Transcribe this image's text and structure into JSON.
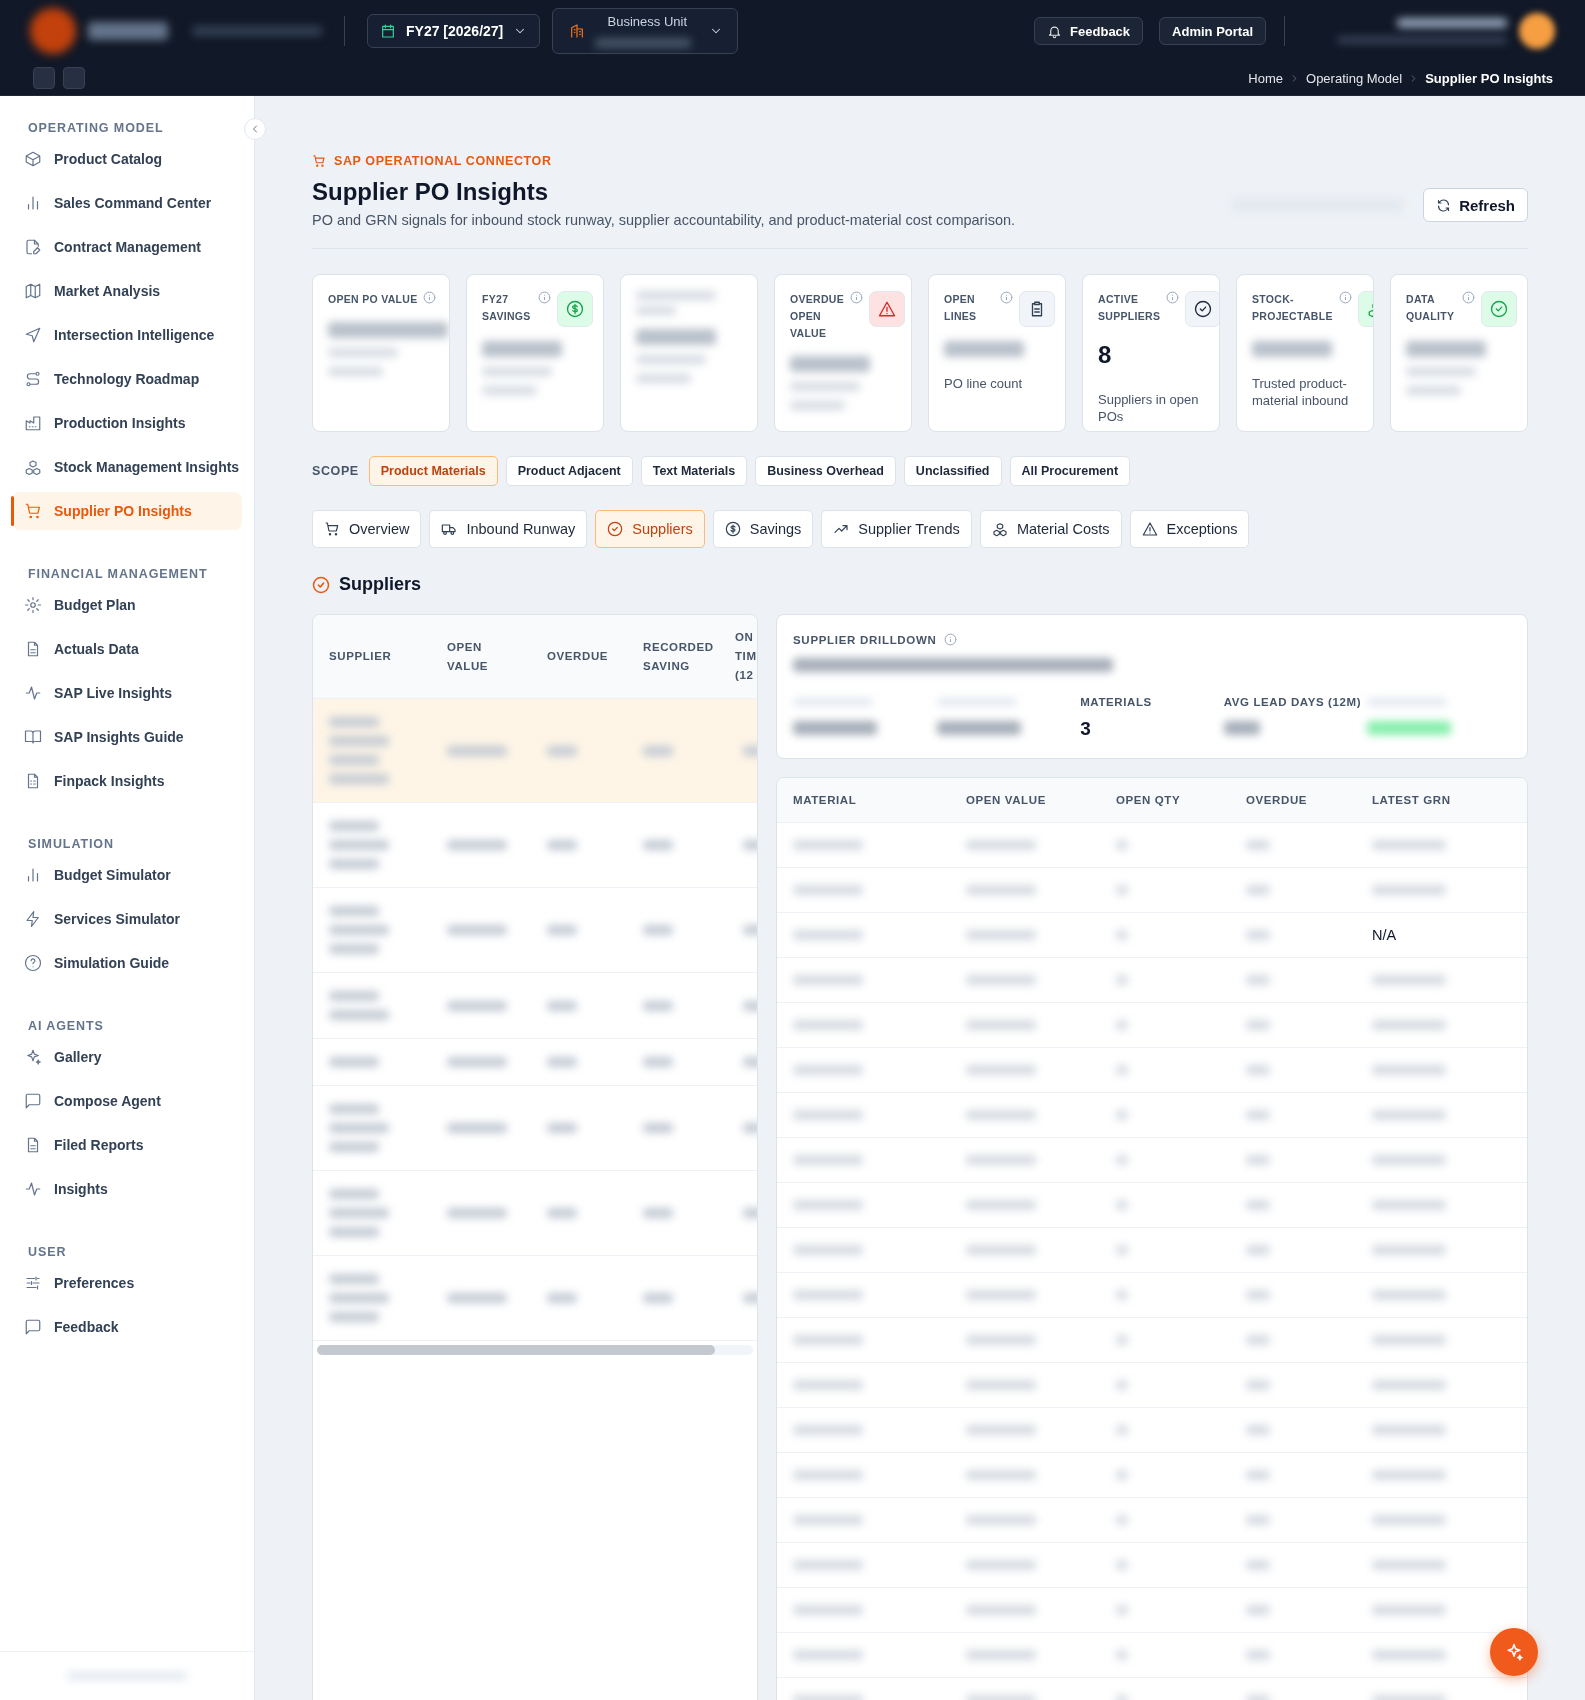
{
  "topbar": {
    "fiscal_year": "FY27 [2026/27]",
    "business_unit_label": "Business Unit",
    "buttons": [
      "Feedback",
      "Admin Portal"
    ],
    "breadcrumb": [
      {
        "label": "Home",
        "current": false
      },
      {
        "label": "Operating Model",
        "current": false
      },
      {
        "label": "Supplier PO Insights",
        "current": true
      }
    ]
  },
  "sidebar": {
    "sections": [
      {
        "title": "OPERATING MODEL",
        "items": [
          {
            "label": "Product Catalog",
            "selected": false
          },
          {
            "label": "Sales Command Center",
            "selected": false
          },
          {
            "label": "Contract Management",
            "selected": false
          },
          {
            "label": "Market Analysis",
            "selected": false
          },
          {
            "label": "Intersection Intelligence",
            "selected": false
          },
          {
            "label": "Technology Roadmap",
            "selected": false
          },
          {
            "label": "Production Insights",
            "selected": false
          },
          {
            "label": "Stock Management Insights",
            "selected": false
          },
          {
            "label": "Supplier PO Insights",
            "selected": true
          }
        ]
      },
      {
        "title": "FINANCIAL MANAGEMENT",
        "items": [
          {
            "label": "Budget Plan",
            "selected": false
          },
          {
            "label": "Actuals Data",
            "selected": false
          },
          {
            "label": "SAP Live Insights",
            "selected": false
          },
          {
            "label": "SAP Insights Guide",
            "selected": false
          },
          {
            "label": "Finpack Insights",
            "selected": false
          }
        ]
      },
      {
        "title": "SIMULATION",
        "items": [
          {
            "label": "Budget Simulator",
            "selected": false
          },
          {
            "label": "Services Simulator",
            "selected": false
          },
          {
            "label": "Simulation Guide",
            "selected": false
          }
        ]
      },
      {
        "title": "AI AGENTS",
        "items": [
          {
            "label": "Gallery",
            "selected": false
          },
          {
            "label": "Compose Agent",
            "selected": false
          },
          {
            "label": "Filed Reports",
            "selected": false
          },
          {
            "label": "Insights",
            "selected": false
          }
        ]
      },
      {
        "title": "USER",
        "items": [
          {
            "label": "Preferences",
            "selected": false
          },
          {
            "label": "Feedback",
            "selected": false
          }
        ]
      }
    ]
  },
  "header": {
    "eyebrow": "SAP OPERATIONAL CONNECTOR",
    "title": "Supplier PO Insights",
    "subtitle": "PO and GRN signals for inbound stock runway, supplier accountability, and product-material cost comparison.",
    "refresh_button": "Refresh"
  },
  "kpi_cards": [
    {
      "label": "OPEN PO VALUE",
      "redacted": true
    },
    {
      "label": "FY27 SAVINGS",
      "redacted": true
    },
    {
      "redacted": true
    },
    {
      "label": "OVERDUE OPEN VALUE",
      "redacted": true
    },
    {
      "label": "OPEN LINES",
      "redacted": true,
      "caption": "PO line count"
    },
    {
      "label": "ACTIVE SUPPLIERS",
      "redacted": false,
      "value": "8",
      "caption": "Suppliers in open POs"
    },
    {
      "label": "STOCK-PROJECTABLE",
      "redacted": true,
      "caption": "Trusted product-material inbound"
    },
    {
      "label": "DATA QUALITY",
      "redacted": true
    }
  ],
  "scope": {
    "label": "SCOPE",
    "options": [
      {
        "label": "Product Materials",
        "selected": true
      },
      {
        "label": "Product Adjacent",
        "selected": false
      },
      {
        "label": "Text Materials",
        "selected": false
      },
      {
        "label": "Business Overhead",
        "selected": false
      },
      {
        "label": "Unclassified",
        "selected": false
      },
      {
        "label": "All Procurement",
        "selected": false
      }
    ]
  },
  "tabs": [
    {
      "label": "Overview",
      "selected": false
    },
    {
      "label": "Inbound Runway",
      "selected": false
    },
    {
      "label": "Suppliers",
      "selected": true
    },
    {
      "label": "Savings",
      "selected": false
    },
    {
      "label": "Supplier Trends",
      "selected": false
    },
    {
      "label": "Material Costs",
      "selected": false
    },
    {
      "label": "Exceptions",
      "selected": false
    }
  ],
  "section_title": "Suppliers",
  "supplier_table": {
    "columns": [
      "SUPPLIER",
      "OPEN VALUE",
      "OVERDUE",
      "RECORDED SAVING",
      "ON TIM (12"
    ],
    "rows": [
      {
        "selected": true,
        "redacted": true
      },
      {
        "selected": false,
        "redacted": true
      },
      {
        "selected": false,
        "redacted": true
      },
      {
        "selected": false,
        "redacted": true
      },
      {
        "selected": false,
        "redacted": true
      },
      {
        "selected": false,
        "redacted": true
      },
      {
        "selected": false,
        "redacted": true
      },
      {
        "selected": false,
        "redacted": true
      }
    ]
  },
  "drilldown": {
    "title": "SUPPLIER DRILLDOWN",
    "stats": [
      {
        "redacted": true
      },
      {
        "redacted": true
      },
      {
        "label": "MATERIALS",
        "value": "3",
        "redacted": false
      },
      {
        "label": "AVG LEAD DAYS (12M)",
        "redacted": true
      },
      {
        "redacted": true
      }
    ]
  },
  "material_table": {
    "columns": [
      "MATERIAL",
      "OPEN VALUE",
      "OPEN QTY",
      "OVERDUE",
      "LATEST GRN"
    ],
    "rows": [
      {
        "redacted": true
      },
      {
        "redacted": true
      },
      {
        "redacted": true,
        "latest_grn": "N/A"
      },
      {
        "redacted": true
      },
      {
        "redacted": true
      },
      {
        "redacted": true
      },
      {
        "redacted": true
      },
      {
        "redacted": true
      },
      {
        "redacted": true
      },
      {
        "redacted": true
      },
      {
        "redacted": true
      },
      {
        "redacted": true
      },
      {
        "redacted": true
      },
      {
        "redacted": true
      },
      {
        "redacted": true
      },
      {
        "redacted": true
      },
      {
        "redacted": true
      },
      {
        "redacted": true
      },
      {
        "redacted": true
      },
      {
        "redacted": true
      }
    ]
  }
}
